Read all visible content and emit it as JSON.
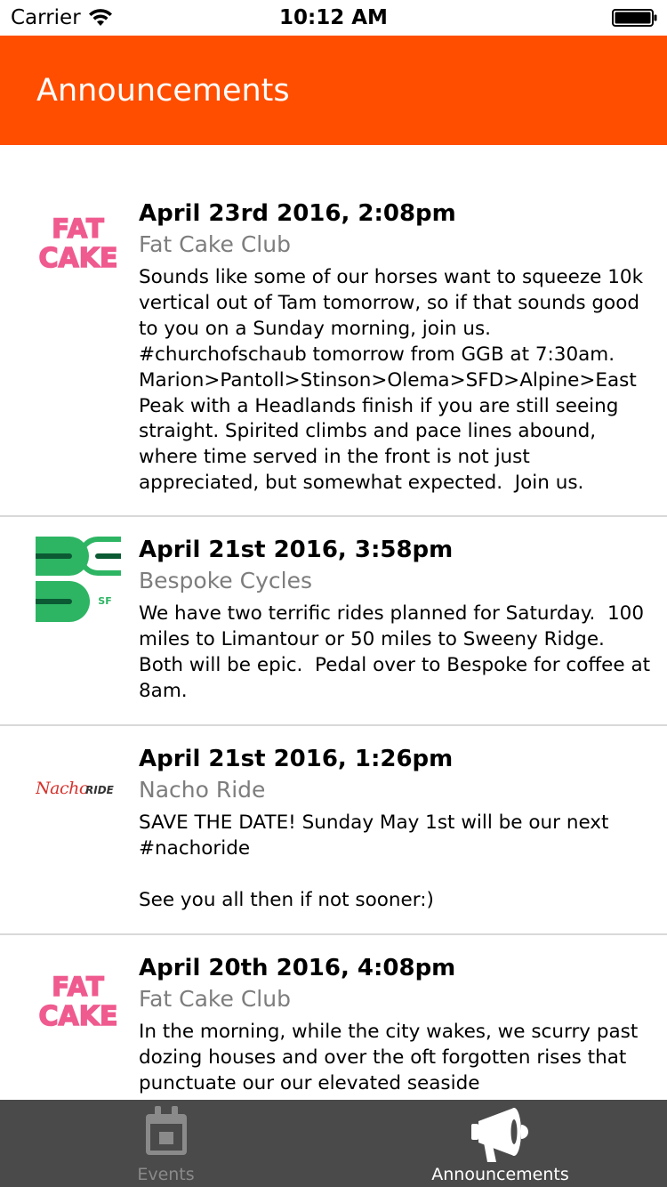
{
  "status_bar": {
    "carrier": "Carrier",
    "time": "10:12 AM",
    "wifi_icon": "wifi-icon",
    "battery_icon": "battery-full-icon"
  },
  "header": {
    "title": "Announcements",
    "background_color": "#ff4e00"
  },
  "posts": [
    {
      "logo": "fat-cake-logo",
      "logo_text_top": "FAT",
      "logo_text_bottom": "CAKE",
      "date": "April 23rd 2016, 2:08pm",
      "club": "Fat Cake Club",
      "text": "Sounds like some of our horses want to squeeze 10k vertical out of Tam tomorrow, so if that sounds good to you on a Sunday morning, join us. #churchofschaub tomorrow from GGB at 7:30am. Marion>Pantoll>Stinson>Olema>SFD>Alpine>East Peak with a Headlands finish if you are still seeing straight. Spirited climbs and pace lines abound, where time served in the front is not just appreciated, but somewhat expected.  Join us."
    },
    {
      "logo": "bespoke-cycles-logo",
      "logo_text": "SF",
      "date": "April 21st 2016, 3:58pm",
      "club": "Bespoke Cycles",
      "text": "We have two terrific rides planned for Saturday.  100 miles to Limantour or 50 miles to Sweeny Ridge.  Both will be epic.  Pedal over to Bespoke for coffee at 8am."
    },
    {
      "logo": "nacho-ride-logo",
      "logo_text_script": "Nacho",
      "logo_text_caps": "RIDE",
      "date": "April 21st 2016, 1:26pm",
      "club": "Nacho Ride",
      "text": "SAVE THE DATE! Sunday May 1st will be our next #nachoride\n\nSee you all then if not sooner:)"
    },
    {
      "logo": "fat-cake-logo",
      "logo_text_top": "FAT",
      "logo_text_bottom": "CAKE",
      "date": "April 20th 2016, 4:08pm",
      "club": "Fat Cake Club",
      "text": "In the morning, while the city wakes, we scurry past dozing houses and over the oft forgotten rises that punctuate our our elevated seaside"
    }
  ],
  "tab_bar": {
    "tabs": [
      {
        "label": "Events",
        "icon": "calendar-icon",
        "active": false
      },
      {
        "label": "Announcements",
        "icon": "megaphone-icon",
        "active": true
      }
    ]
  },
  "colors": {
    "accent": "#ff4e00",
    "fat_cake_pink": "#ef5a8f",
    "bespoke_green": "#2db563",
    "nacho_red": "#d6312b",
    "tab_bar_bg": "#4a4a4a"
  }
}
